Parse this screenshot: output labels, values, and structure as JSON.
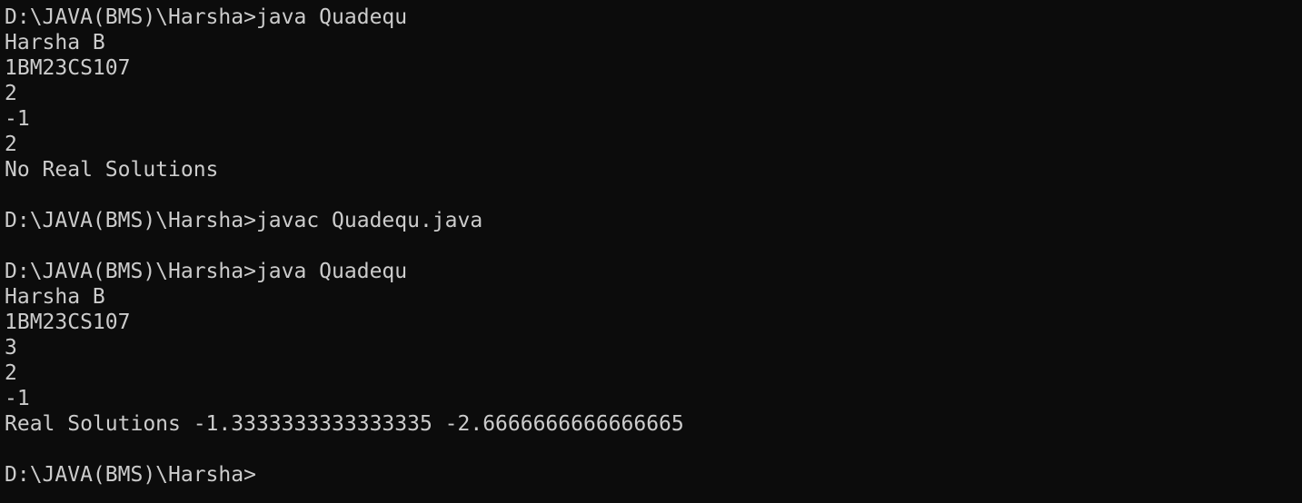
{
  "terminal": {
    "background": "#0c0c0c",
    "foreground": "#cccccc",
    "lines": [
      "D:\\JAVA(BMS)\\Harsha>java Quadequ",
      "Harsha B",
      "1BM23CS107",
      "2",
      "-1",
      "2",
      "No Real Solutions",
      "",
      "D:\\JAVA(BMS)\\Harsha>javac Quadequ.java",
      "",
      "D:\\JAVA(BMS)\\Harsha>java Quadequ",
      "Harsha B",
      "1BM23CS107",
      "3",
      "2",
      "-1",
      "Real Solutions -1.3333333333333335 -2.6666666666666665",
      "",
      "D:\\JAVA(BMS)\\Harsha>"
    ]
  }
}
